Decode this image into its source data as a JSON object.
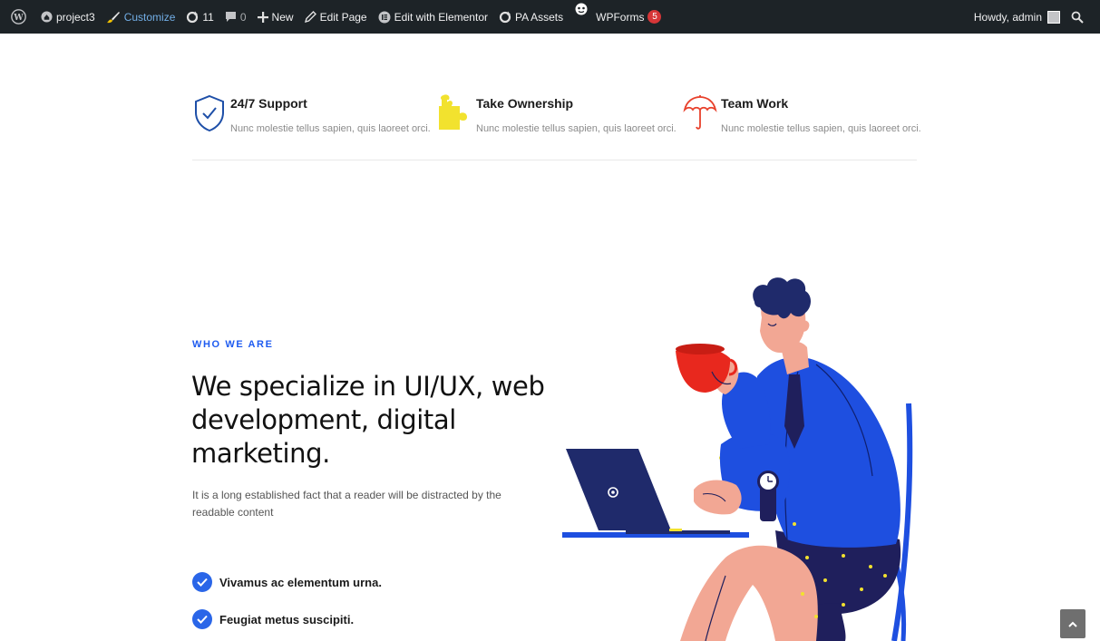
{
  "adminbar": {
    "site_name": "project3",
    "customize": "Customize",
    "updates_count": "11",
    "comments_count": "0",
    "new_label": "New",
    "edit_page": "Edit Page",
    "edit_elementor": "Edit with Elementor",
    "pa_assets": "PA Assets",
    "wpforms": "WPForms",
    "wpforms_badge": "5",
    "howdy": "Howdy, admin"
  },
  "features": [
    {
      "icon": "shield-check-icon",
      "title": "24/7 Support",
      "text": "Nunc molestie tellus sapien, quis laoreet orci."
    },
    {
      "icon": "puzzle-icon",
      "title": "Take Ownership",
      "text": "Nunc molestie tellus sapien, quis laoreet orci."
    },
    {
      "icon": "umbrella-icon",
      "title": "Team Work",
      "text": "Nunc molestie tellus sapien, quis laoreet orci."
    }
  ],
  "about": {
    "eyebrow": "WHO WE ARE",
    "headline": "We specialize in UI/UX, web development, digital marketing.",
    "lead": "It is a long established fact that a reader will be distracted by the readable content",
    "checks": [
      "Vivamus ac elementum urna.",
      "Feugiat metus suscipiti."
    ]
  },
  "colors": {
    "adminbar_bg": "#1d2327",
    "accent_blue": "#1e5bf0",
    "badge_red": "#d63638",
    "puzzle_yellow": "#f2e22e",
    "umbrella_red": "#e8412c"
  }
}
